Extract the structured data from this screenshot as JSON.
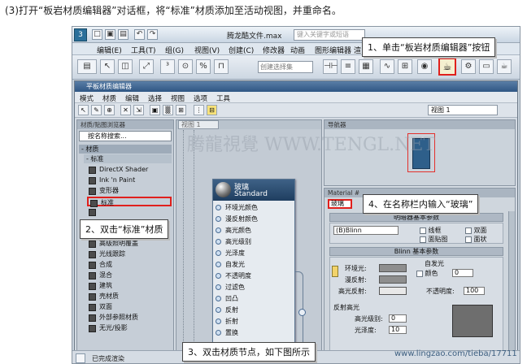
{
  "caption": "(3)打开“板岩材质编辑器”对话框，将“标准”材质添加至活动视图，并重命名。",
  "app": {
    "logo": "3",
    "title": "腾龙酷文件.max",
    "search_placeholder": "键入关键字或短语",
    "menu": [
      "编辑(E)",
      "工具(T)",
      "组(G)",
      "视图(V)",
      "创建(C)",
      "修改器",
      "动画",
      "图形编辑器",
      "渲"
    ],
    "quick_access": [
      "□",
      "▣",
      "▤",
      "↶",
      "↷"
    ],
    "toolbar_icons": [
      "▤",
      "↖",
      "◫",
      "⤢",
      "³",
      "⊙",
      "%",
      "⊓"
    ],
    "selection_set_placeholder": "创建选择集",
    "material_editor_icon": "teapot-icon"
  },
  "slate": {
    "title": "平板材质编辑器",
    "menu": [
      "模式",
      "材质",
      "编辑",
      "选择",
      "视图",
      "选项",
      "工具"
    ],
    "view_select": "视图 1",
    "browser": {
      "header": "材质/贴图浏览器",
      "search_placeholder": "按名称搜索...",
      "group": "- 材质",
      "subgroup": "- 标准",
      "items": [
        "DirectX Shader",
        "Ink 'n Paint",
        "变形器",
        "标准",
        "",
        "",
        "",
        "高级照明覆盖",
        "光线跟踪",
        "合成",
        "混合",
        "建筑",
        "壳材质",
        "双面",
        "外部参照材质",
        "无光/投影"
      ]
    },
    "view": {
      "tab": "视图 1",
      "node_name": "玻璃",
      "node_type": "Standard",
      "slots": [
        "环境光颜色",
        "漫反射颜色",
        "高光颜色",
        "高光级别",
        "光泽度",
        "自发光",
        "不透明度",
        "过滤色",
        "凹凸",
        "反射",
        "折射",
        "置换"
      ]
    },
    "navigator": {
      "header": "导航器"
    },
    "params": {
      "header": "Material #",
      "name_value": "玻璃",
      "rollout1": "明暗器基本参数",
      "shader": "(B)Blinn",
      "checks": [
        "线框",
        "双面",
        "面贴图",
        "面状"
      ],
      "rollout2": "Blinn 基本参数",
      "self_illum": "自发光",
      "color_label": "颜色",
      "color_value": "0",
      "ambient": "环境光:",
      "diffuse": "漫反射:",
      "specular": "高光反射:",
      "opacity_label": "不透明度:",
      "opacity_value": "100",
      "highlight_group": "反射高光",
      "spec_level": "高光级别:",
      "spec_level_value": "0",
      "gloss": "光泽度:",
      "gloss_value": "10"
    },
    "status": "已完成渲染"
  },
  "callouts": {
    "c1": "1、单击“板岩材质编辑器”按钮",
    "c2": "2、双击“标准”材质",
    "c3": "3、双击材质节点，如下图所示",
    "c4": "4、在名称栏内输入“玻璃”"
  },
  "watermarks": {
    "wm1": "腾龍視覺 WWW.TENGL.NET",
    "wm2": "www.lingzao.com/tieba/17711"
  },
  "colors": {
    "highlight": "#e0201c",
    "title_bar": "#2f5684",
    "node_header": "#1f3e60"
  }
}
